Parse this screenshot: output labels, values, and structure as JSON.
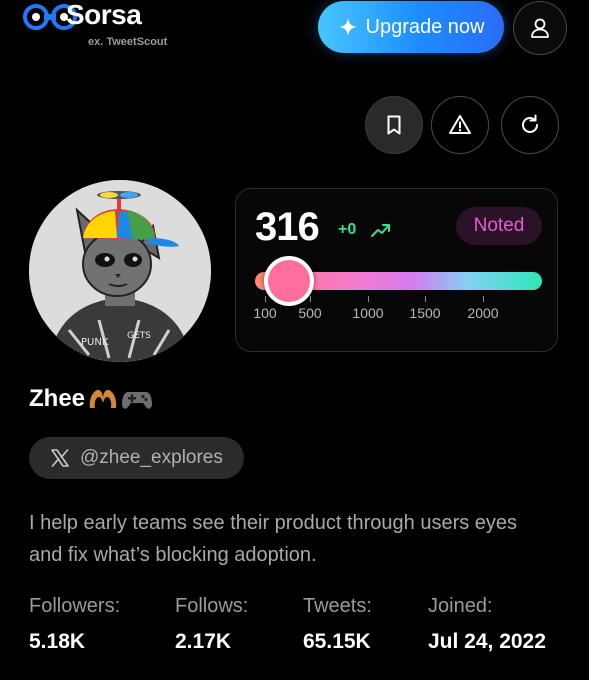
{
  "header": {
    "app_name": "Sorsa",
    "app_subtitle": "ex. TweetScout",
    "upgrade_label": "Upgrade now",
    "icons": [
      "sorsa-logo-icon",
      "sparkle-icon",
      "user-icon"
    ]
  },
  "actions": {
    "icons": [
      "bookmark-icon",
      "warning-icon",
      "refresh-icon"
    ]
  },
  "score": {
    "value": "316",
    "delta": "+0",
    "badge": "Noted",
    "slider_value": 316,
    "slider_range": [
      100,
      2000
    ],
    "ticks": [
      "100",
      "500",
      "1000",
      "1500",
      "2000"
    ],
    "colors": {
      "delta": "#33e08f",
      "badge_text": "#e85bd3",
      "thumb": "#ff6f9e"
    }
  },
  "profile": {
    "name": "Zhee",
    "name_emojis": [
      "heart-hands-emoji",
      "game-controller-emoji"
    ],
    "handle": "@zhee_explores",
    "bio": "I help early teams see their product through users eyes and fix what’s blocking adoption."
  },
  "stats": [
    {
      "label": "Followers:",
      "value": "5.18K"
    },
    {
      "label": "Follows:",
      "value": "2.17K"
    },
    {
      "label": "Tweets:",
      "value": "65.15K"
    },
    {
      "label": "Joined:",
      "value": "Jul 24, 2022"
    }
  ],
  "brand_colors": {
    "accent_blue": "#1d8cff",
    "logo_blue": "#1e7bff"
  }
}
